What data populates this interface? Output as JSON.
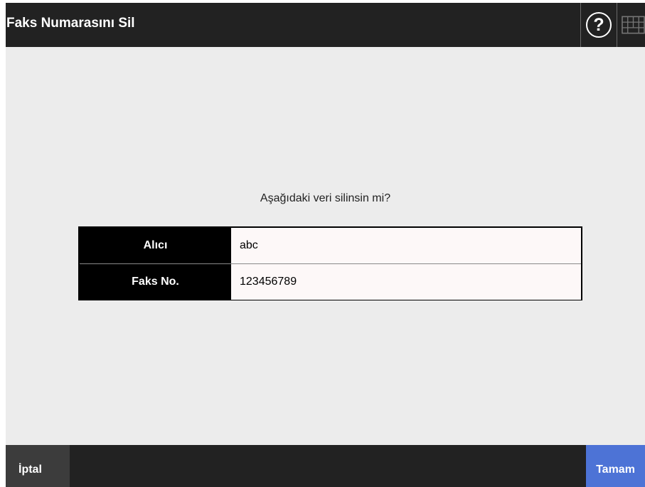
{
  "header": {
    "title": "Faks Numarasını Sil",
    "help_icon_text": "?",
    "keyboard_icon": "keyboard-icon"
  },
  "main": {
    "question": "Aşağıdaki veri silinsin mi?",
    "rows": [
      {
        "label": "Alıcı",
        "value": "abc"
      },
      {
        "label": "Faks No.",
        "value": "123456789"
      }
    ]
  },
  "footer": {
    "cancel_label": "İptal",
    "ok_label": "Tamam"
  },
  "colors": {
    "header_bg": "#222222",
    "content_bg": "#ececec",
    "ok_button": "#4d73d6",
    "cancel_button": "#3c3c3c"
  }
}
